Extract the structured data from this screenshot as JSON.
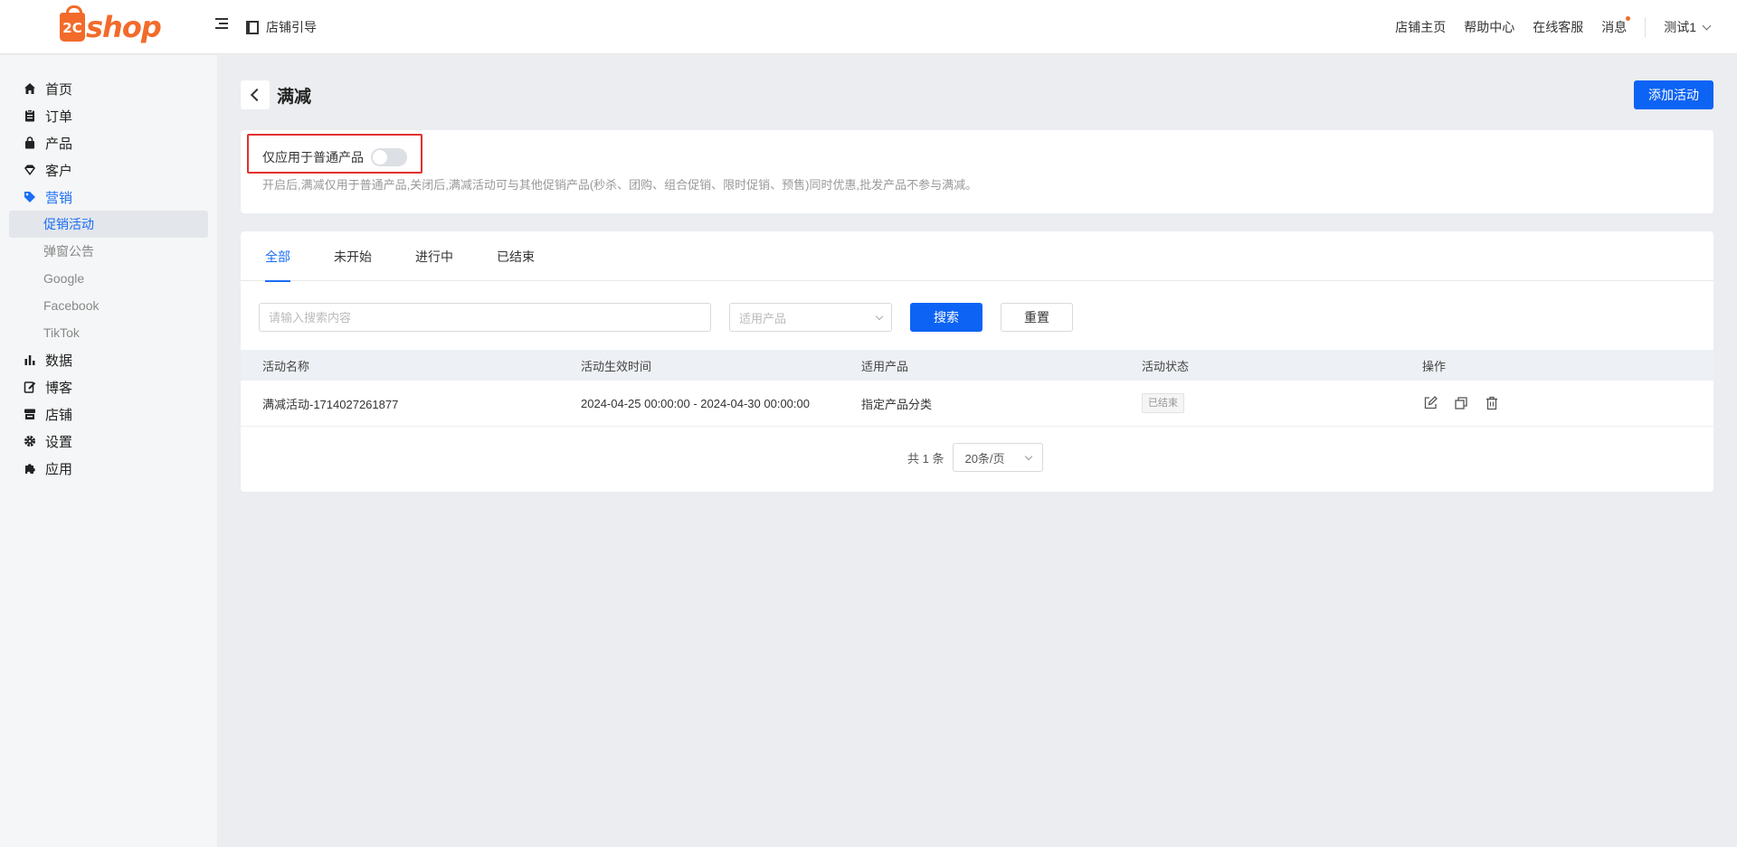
{
  "header": {
    "logo_mark": "2C",
    "logo_text": "shop",
    "guide_label": "店铺引导",
    "links": [
      "店铺主页",
      "帮助中心",
      "在线客服",
      "消息"
    ],
    "user_name": "测试1"
  },
  "sidebar": {
    "items": [
      {
        "label": "首页",
        "icon": "home-icon"
      },
      {
        "label": "订单",
        "icon": "order-icon"
      },
      {
        "label": "产品",
        "icon": "product-bag-icon"
      },
      {
        "label": "客户",
        "icon": "customer-icon"
      },
      {
        "label": "营销",
        "icon": "tag-icon"
      }
    ],
    "sub_items": [
      "促销活动",
      "弹窗公告",
      "Google",
      "Facebook",
      "TikTok"
    ],
    "items_after": [
      {
        "label": "数据",
        "icon": "bar-chart-icon"
      },
      {
        "label": "博客",
        "icon": "edit-icon"
      },
      {
        "label": "店铺",
        "icon": "store-icon"
      },
      {
        "label": "设置",
        "icon": "gear-icon"
      },
      {
        "label": "应用",
        "icon": "puzzle-icon"
      }
    ]
  },
  "page": {
    "title": "满减",
    "add_button": "添加活动"
  },
  "setting": {
    "switch_label": "仅应用于普通产品",
    "switch_on": false,
    "description": "开启后,满减仅用于普通产品,关闭后,满减活动可与其他促销产品(秒杀、团购、组合促销、限时促销、预售)同时优惠,批发产品不参与满减。"
  },
  "tabs": [
    "全部",
    "未开始",
    "进行中",
    "已结束"
  ],
  "filters": {
    "search_placeholder": "请输入搜索内容",
    "product_placeholder": "适用产品",
    "search_button": "搜索",
    "reset_button": "重置"
  },
  "table": {
    "headers": [
      "活动名称",
      "活动生效时间",
      "适用产品",
      "活动状态",
      "操作"
    ],
    "rows": [
      {
        "name": "满减活动-1714027261877",
        "time": "2024-04-25 00:00:00 - 2024-04-30 00:00:00",
        "product": "指定产品分类",
        "status": "已结束"
      }
    ]
  },
  "pagination": {
    "total": "共 1 条",
    "page_size": "20条/页"
  },
  "colors": {
    "accent": "#0d63f3",
    "brand": "#f26b2a",
    "highlight": "#e0302e"
  }
}
